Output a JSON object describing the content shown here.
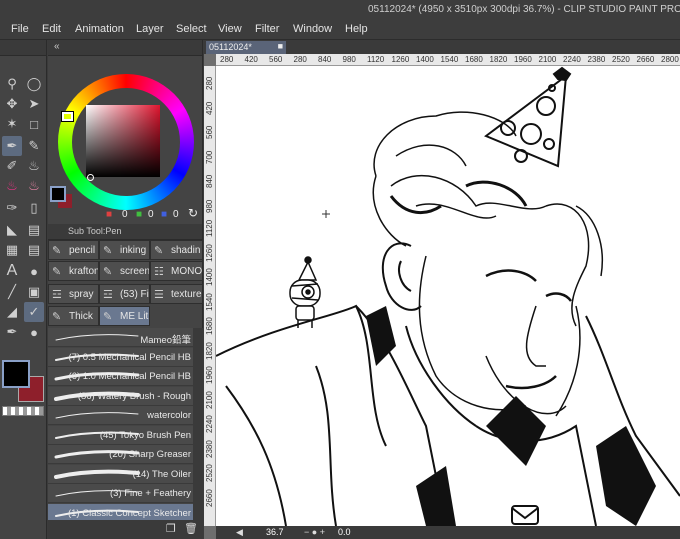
{
  "window": {
    "title": "05112024* (4950 x 3510px 300dpi 36.7%)  - CLIP STUDIO PAINT PRO"
  },
  "menu": [
    "File",
    "Edit",
    "Animation",
    "Layer",
    "Select",
    "View",
    "Filter",
    "Window",
    "Help"
  ],
  "color_panel": {
    "r": "0",
    "g": "0",
    "b": "0",
    "r_color": "#e04040",
    "g_color": "#40c040",
    "b_color": "#4060e0"
  },
  "subtool_panel": {
    "title": "Sub Tool:Pen"
  },
  "subtool_tabs": [
    "pencil",
    "inking",
    "shadin",
    "krafton",
    "screen",
    "MONO",
    "spray",
    "(53) Fi",
    "texture",
    "Thick",
    "ME Lit"
  ],
  "brushes": [
    "Mameo鉛筆",
    "(7) 0.5 Mechanical Pencil HB",
    "(6) 1.0 Mechanical Pencil HB",
    "(86) Watery Brush - Rough",
    "watercolor",
    "(45) Tokyo Brush Pen",
    "(20) Sharp Greaser",
    "(14) The Oiler",
    "(3) Fine + Feathery",
    "(1) Classic Concept Sketcher"
  ],
  "canvas": {
    "tab": "05112024*"
  },
  "ruler": {
    "h": [
      "280",
      "420",
      "560",
      "280",
      "840",
      "980",
      "1120",
      "1260",
      "1400",
      "1540",
      "1680",
      "1820",
      "1960",
      "2100",
      "2240",
      "2380",
      "2520",
      "2660",
      "2800"
    ],
    "v": [
      "280",
      "420",
      "560",
      "700",
      "840",
      "980",
      "1120",
      "1260",
      "1400",
      "1540",
      "1680",
      "1820",
      "1960",
      "2100",
      "2240",
      "2380",
      "2520",
      "2660"
    ]
  },
  "status": {
    "zoom": "36.7",
    "angle": "0.0"
  },
  "colors": {
    "main": "#000000",
    "sub": "#8e1f2b",
    "accent": "#5d6b80"
  },
  "icons": [
    "zoom-icon",
    "move-icon",
    "operation-icon",
    "lasso-icon",
    "magic-wand-icon",
    "eyedropper-icon",
    "pen-icon",
    "pencil-icon",
    "brush-icon",
    "airbrush-icon",
    "decoration-icon",
    "eraser-icon",
    "blend-icon",
    "fill-icon",
    "gradient-icon",
    "figure-icon",
    "frame-icon",
    "ruler-icon",
    "text-icon",
    "balloon-icon",
    "line-icon",
    "correction-icon"
  ]
}
